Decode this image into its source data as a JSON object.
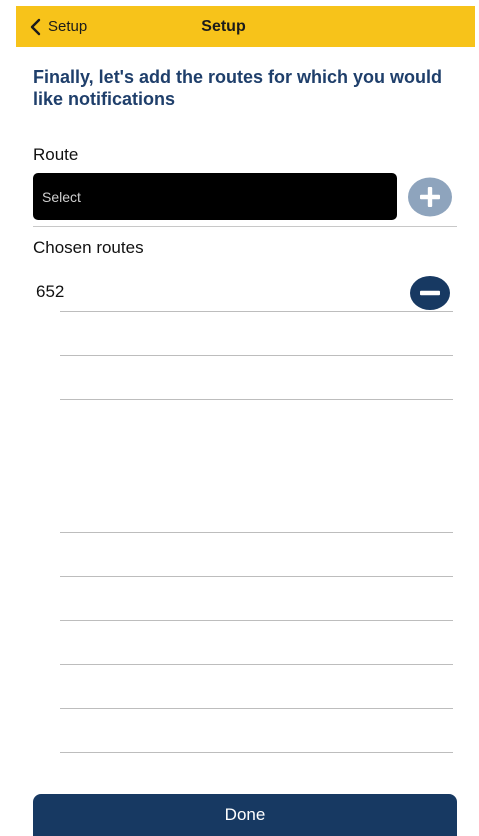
{
  "nav": {
    "back_label": "Setup",
    "title": "Setup"
  },
  "headline": "Finally, let's add the routes for which you would like notifications",
  "route_field": {
    "label": "Route",
    "placeholder": "Select"
  },
  "chosen": {
    "label": "Chosen routes",
    "routes": [
      "652"
    ]
  },
  "done_label": "Done",
  "colors": {
    "nav_bar": "#f7c31a",
    "headline": "#1f3f6b",
    "add_button": "#8ea4bd",
    "remove_button": "#173962",
    "done_button": "#173962"
  },
  "icons": {
    "back": "chevron-left-icon",
    "add": "plus-circle-icon",
    "remove": "minus-circle-icon"
  }
}
